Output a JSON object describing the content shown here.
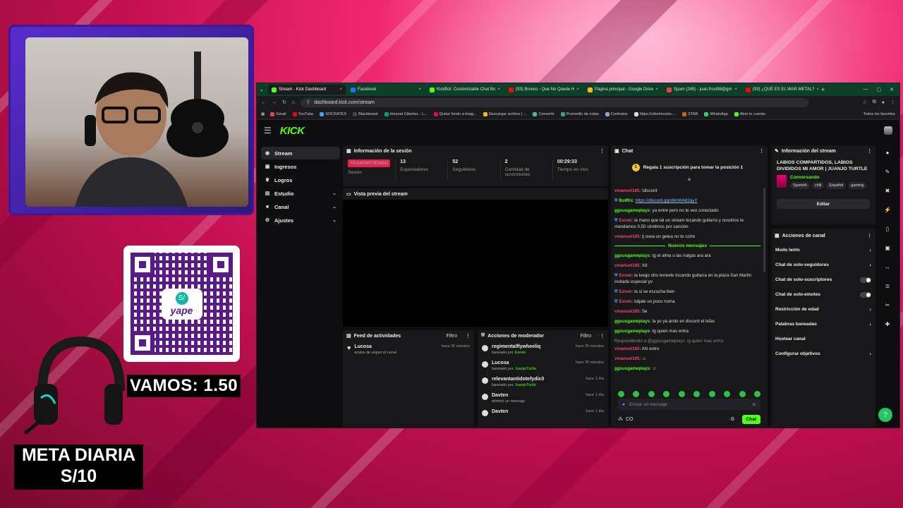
{
  "overlay": {
    "vamos": "VAMOS: 1.50",
    "meta_line1": "META DIARIA",
    "meta_line2": "S/10",
    "qr_brand": "yape",
    "qr_badge": "S/"
  },
  "browser": {
    "tabs": [
      {
        "label": "Stream - Kick Dashboard",
        "color": "#53fc18"
      },
      {
        "label": "Facebook",
        "color": "#1877f2"
      },
      {
        "label": "KickBot: Customizable Chat Bo",
        "color": "#53fc18"
      },
      {
        "label": "(93) Bronco - Que No Quede H",
        "color": "#ff0000"
      },
      {
        "label": "Página principal - Google Drive",
        "color": "#fbbc04"
      },
      {
        "label": "Spam (245) - juan.frost98@gm",
        "color": "#ea4335"
      },
      {
        "label": "(93) ¿QUÉ ES EL WAR METAL?",
        "color": "#ff0000"
      }
    ],
    "new_tab": "+",
    "url": "dashboard.kick.com/stream",
    "bookmarks": [
      "Gmail",
      "YouTube",
      "SOCRATES",
      "Blackboard",
      "Intranet Cibertec - L...",
      "Quitar fondo a imag...",
      "Descargar archivo | ...",
      "Convertir",
      "Promedio de notas",
      "Contratos",
      "https://cibertecedu-...",
      "STAR",
      "WhatsApp",
      "Abre tu cuenta"
    ],
    "all_bookmarks": "Todos los favoritos"
  },
  "kick": {
    "logo": "KICK",
    "nav": [
      {
        "label": "Stream",
        "icon": "◉"
      },
      {
        "label": "Ingresos",
        "icon": "▣"
      },
      {
        "label": "Logros",
        "icon": "♛"
      },
      {
        "label": "Estudio",
        "icon": "▤"
      },
      {
        "label": "Canal",
        "icon": "■"
      },
      {
        "label": "Ajustes",
        "icon": "⚙"
      }
    ],
    "session": {
      "title": "Información de la sesión",
      "live_badge": "TRANSMITIENDO",
      "live_label": "Sesión",
      "stats": [
        {
          "value": "13",
          "label": "Espectadores"
        },
        {
          "value": "52",
          "label": "Seguidores"
        },
        {
          "value": "2",
          "label": "Cantidad de suscriciones"
        },
        {
          "value": "00:29:33",
          "label": "Tiempo en vivo"
        }
      ]
    },
    "preview_title": "Vista previa del stream",
    "activity": {
      "title": "Feed de actividades",
      "filter": "Filtro",
      "items": [
        {
          "user": "Lucosa",
          "text": "acaba de seguir el canal",
          "time": "hace 26 minutos"
        }
      ]
    },
    "mod": {
      "title": "Acciones de moderador",
      "filter": "Filtro",
      "items": [
        {
          "user": "regimentalflywheeliq",
          "pre": "baneado por",
          "by": "Exnek",
          "time": "hace 25 minutos"
        },
        {
          "user": "Lucosa",
          "pre": "baneado por",
          "by": "JuanjoTurtle",
          "time": "hace 25 minutos"
        },
        {
          "user": "relevantantidotefydic0",
          "pre": "baneado por",
          "by": "JuanjoTurtle",
          "time": "hace 1 día"
        },
        {
          "user": "Davten",
          "pre": "eliminó un mensaje",
          "by": "",
          "time": "hace 1 día"
        },
        {
          "user": "Davten",
          "pre": "",
          "by": "",
          "time": "hace 1 día"
        }
      ]
    },
    "chat": {
      "title": "Chat",
      "pinned": "Regala 1 suscripción para tomar la posición 1",
      "new_messages": "Nuevos mensajes",
      "messages": [
        {
          "user": "vmanuel185",
          "cls": "u-red",
          "text": "!discord"
        },
        {
          "user": "BotRix",
          "cls": "u-grn",
          "text": "https://discord.gg/s9mWA62ayY",
          "link": true
        },
        {
          "user": "ggsusgameplays",
          "cls": "u-grn",
          "text": "ya entre pero no te veo conectado"
        },
        {
          "user": "Exnek",
          "cls": "u-red",
          "text": "la mano que tal un stream tocando guitarra y nosotros te mandamos 0.50 céntimos por canción"
        },
        {
          "user": "vmanuel185",
          "cls": "u-red",
          "text": "tj osea un getea no te corre"
        },
        {
          "user": "ggsusgameplays",
          "cls": "u-grn",
          "text": "tg el alma o las nalgas ara ara"
        },
        {
          "user": "vmanuel185",
          "cls": "u-red",
          "text": "Xd"
        },
        {
          "user": "Exnek",
          "cls": "u-red",
          "text": "la luego otro lerreele tocando guitarra en la plaza San Martin invitado especial yo"
        },
        {
          "user": "Exnek",
          "cls": "u-red",
          "text": "la si se escucha bien"
        },
        {
          "user": "Exnek",
          "cls": "u-red",
          "text": "bájale un poco noma"
        },
        {
          "user": "vmanuel185",
          "cls": "u-red",
          "text": "Se"
        },
        {
          "user": "ggsusgameplays",
          "cls": "u-grn",
          "text": "la yo ya ando en discord el lefas"
        },
        {
          "user": "ggsusgameplays",
          "cls": "u-grn",
          "text": "tg quien mas entra"
        },
        {
          "user": "vmanuel185",
          "cls": "u-red",
          "text": "Ahi entro"
        },
        {
          "user": "vmanuel185",
          "cls": "u-red",
          "text": ""
        },
        {
          "user": "ggsusgameplays",
          "cls": "u-grn",
          "text": ""
        }
      ],
      "reply_note": "Respondiendo a @ggsusgameplays: tg quien mas entra",
      "input_placeholder": "Enviar un mensaje",
      "send": "Chat",
      "co": "CO"
    },
    "stream_info": {
      "title": "Información del stream",
      "stream_title": "LABIOS COMPARTIDOS, LABIOS DIVIDIDOS MI AMOR | JUANJO TURTLE",
      "category": "Conversando",
      "tags": [
        "Spanish",
        "chill",
        "Español",
        "gaming"
      ],
      "edit": "Editar"
    },
    "channel_actions": {
      "title": "Acciones de canal",
      "options": [
        {
          "label": "Modo lento",
          "kind": "chev"
        },
        {
          "label": "Chat de solo-seguidores",
          "kind": "chev"
        },
        {
          "label": "Chat de solo-suscriptores",
          "kind": "toggle"
        },
        {
          "label": "Chat de solo-emotes",
          "kind": "toggle"
        },
        {
          "label": "Restricción de edad",
          "kind": "chev"
        },
        {
          "label": "Palabras baneadas",
          "kind": "chev"
        },
        {
          "label": "Hostear canal",
          "kind": "none"
        },
        {
          "label": "Configurar objetivos",
          "kind": "chev"
        }
      ]
    }
  }
}
